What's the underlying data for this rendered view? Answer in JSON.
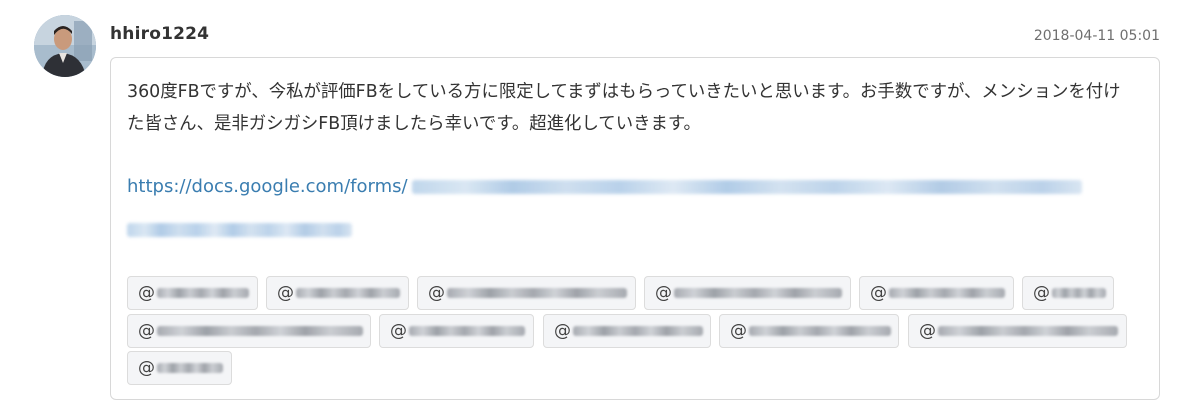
{
  "post": {
    "username": "hhiro1224",
    "timestamp": "2018-04-11 05:01",
    "message": "360度FBですが、今私が評価FBをしている方に限定してまずはもらっていきたいと思います。お手数ですが、メンションを付けた皆さん、是非ガシガシFB頂けましたら幸いです。超進化していきます。",
    "link_prefix": "https://docs.google.com/forms/",
    "mention_prefix": "@",
    "mention_count": 12
  },
  "icons": {
    "avatar": "user-avatar-photo"
  },
  "colors": {
    "link": "#3a7db0",
    "bubble_border": "#d8d8d8",
    "chip_background": "#f4f5f7",
    "timestamp": "#6f6f6f"
  }
}
